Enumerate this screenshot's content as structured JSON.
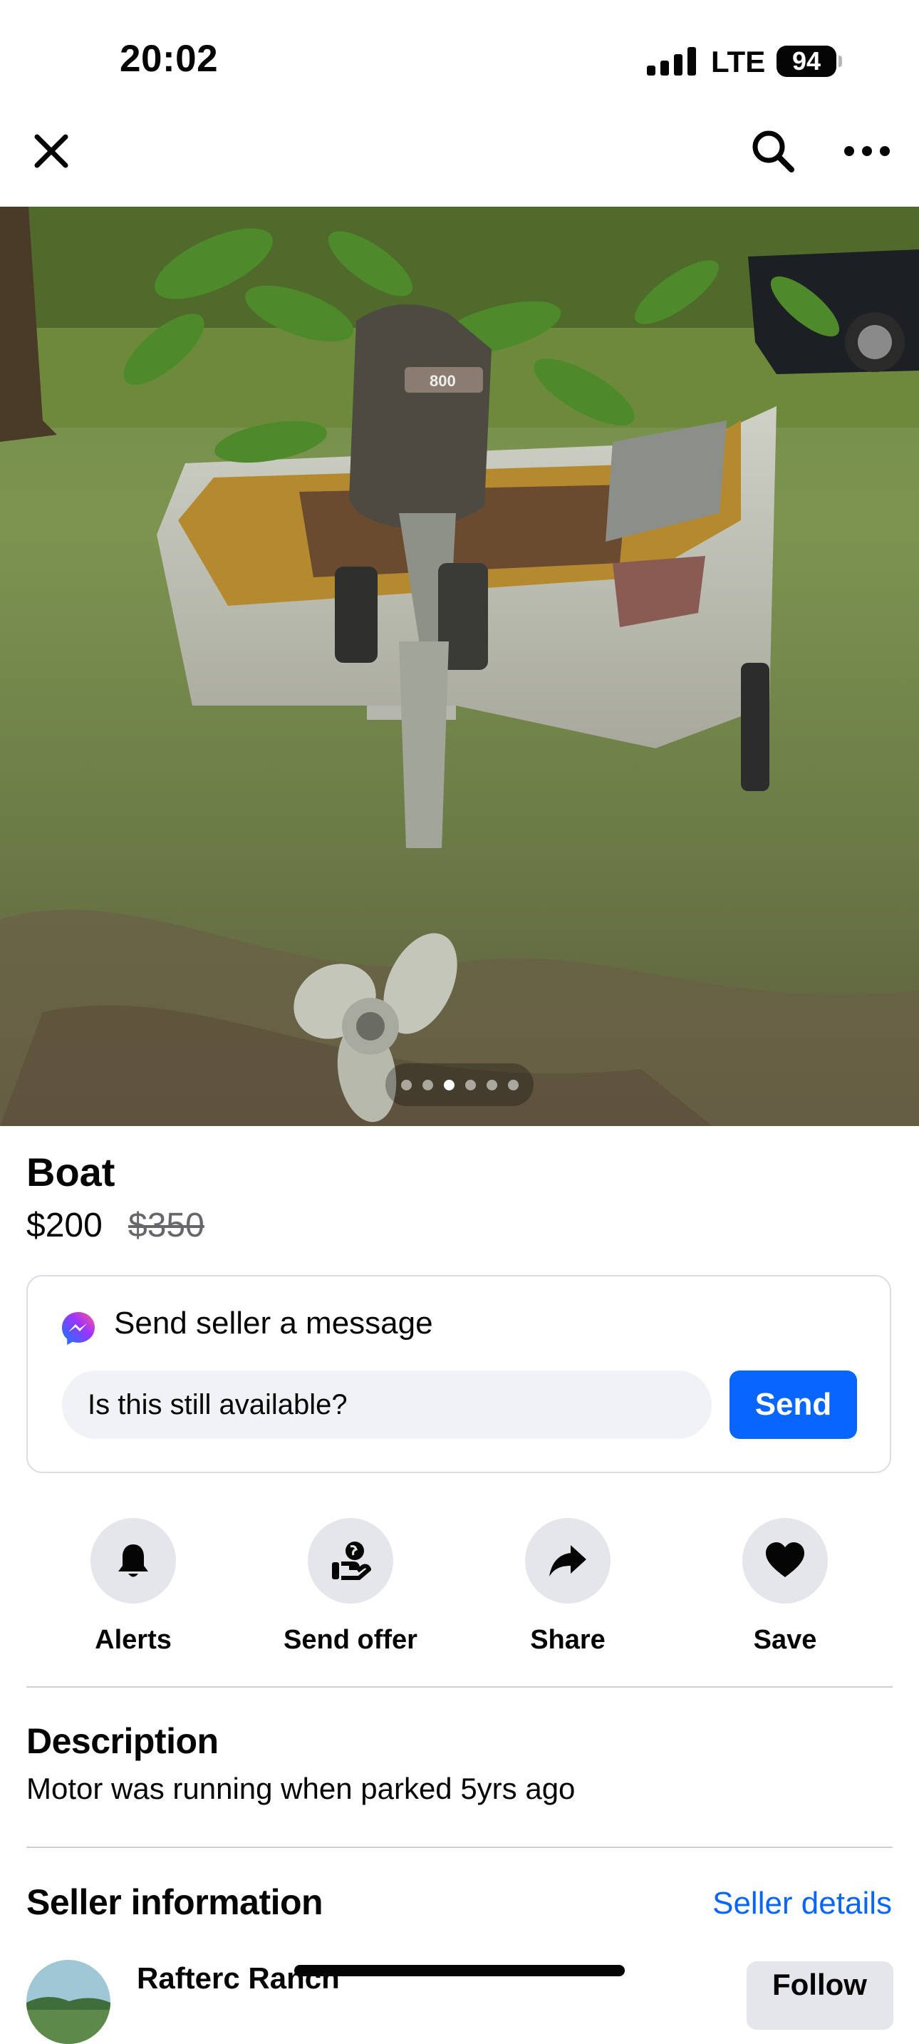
{
  "status_bar": {
    "time": "20:02",
    "network": "LTE",
    "battery": "94"
  },
  "nav": {
    "close_icon": "close-icon",
    "search_icon": "search-icon",
    "more_icon": "more-icon"
  },
  "photo": {
    "subject": "boat-photo",
    "dot_count": 6,
    "active_dot": 3,
    "motor_badge": "800"
  },
  "listing": {
    "title": "Boat",
    "price": "$200",
    "original_price": "$350"
  },
  "message": {
    "heading": "Send seller a message",
    "input_value": "Is this still available?",
    "send_label": "Send"
  },
  "actions": [
    {
      "label": "Alerts",
      "icon": "bell-icon"
    },
    {
      "label": "Send offer",
      "icon": "offer-icon"
    },
    {
      "label": "Share",
      "icon": "share-icon"
    },
    {
      "label": "Save",
      "icon": "heart-icon"
    }
  ],
  "description": {
    "heading": "Description",
    "text": "Motor was running when parked 5yrs ago"
  },
  "seller": {
    "heading": "Seller information",
    "details_link": "Seller details",
    "name": "Rafterc Ranch",
    "follow_label": "Follow"
  },
  "colors": {
    "accent": "#0866ff",
    "chip": "#e4e6eb",
    "input_bg": "#f0f2f5",
    "divider": "#ced0d4"
  }
}
